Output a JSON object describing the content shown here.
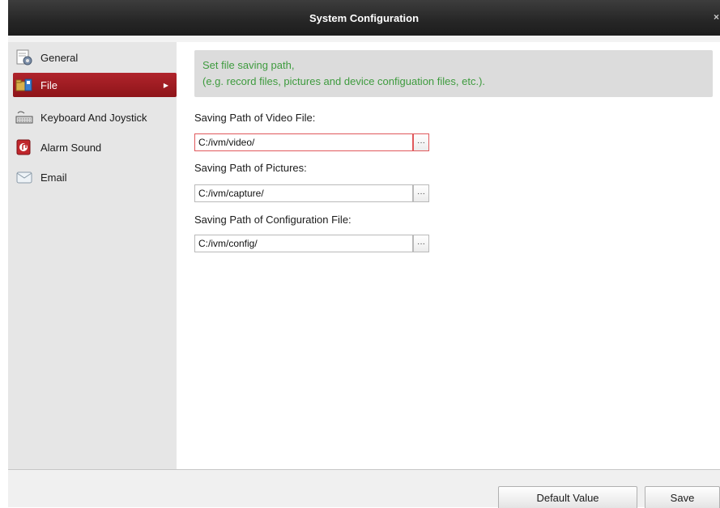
{
  "window": {
    "title": "System Configuration",
    "close_glyph": "×"
  },
  "sidebar": {
    "items": [
      {
        "label": "General",
        "icon": "general-settings-icon"
      },
      {
        "label": "File",
        "icon": "file-folder-icon",
        "active": true
      },
      {
        "label": "Keyboard And Joystick",
        "icon": "keyboard-icon"
      },
      {
        "label": "Alarm Sound",
        "icon": "alarm-sound-icon"
      },
      {
        "label": "Email",
        "icon": "email-icon"
      }
    ]
  },
  "main": {
    "info_line1": "Set file saving path,",
    "info_line2": "(e.g. record files, pictures and device configuation files, etc.).",
    "video": {
      "label": "Saving Path of Video File:",
      "value": "C:/ivm/video/"
    },
    "pictures": {
      "label": "Saving Path of Pictures:",
      "value": "C:/ivm/capture/"
    },
    "config": {
      "label": "Saving Path of Configuration File:",
      "value": "C:/ivm/config/"
    },
    "browse_label": "···"
  },
  "footer": {
    "default_label": "Default Value",
    "save_label": "Save"
  },
  "colors": {
    "accent": "#a01c22",
    "info_text": "#3e9b3e",
    "titlebar": "#2a2a2a"
  }
}
